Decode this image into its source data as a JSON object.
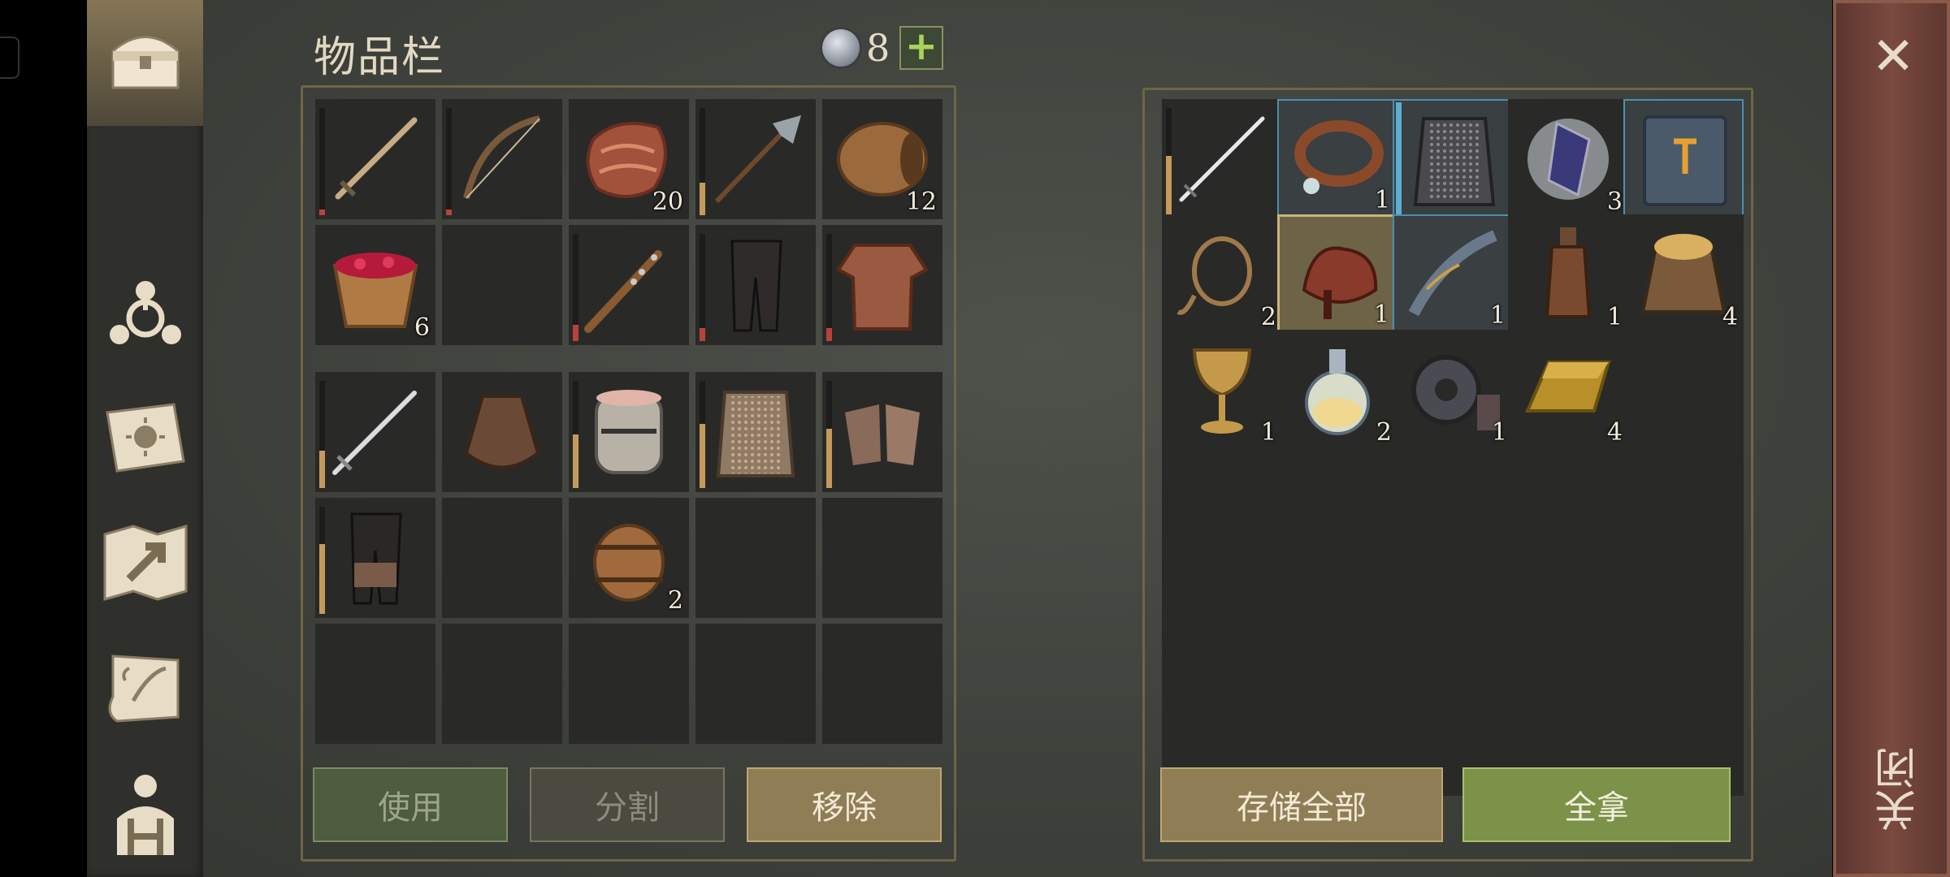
{
  "inventory": {
    "title": "物品栏",
    "currency_count": "8",
    "add_label": "+",
    "slots_main": [
      {
        "icon": "sword",
        "durability": 0.05,
        "dur_color": "#b8433a",
        "count": ""
      },
      {
        "icon": "bow",
        "durability": 0.05,
        "dur_color": "#b8433a",
        "count": ""
      },
      {
        "icon": "meat",
        "durability": null,
        "count": "20"
      },
      {
        "icon": "halberd",
        "durability": 0.3,
        "dur_color": "#c49a5c",
        "count": ""
      },
      {
        "icon": "barrel-log",
        "durability": null,
        "count": "12"
      },
      {
        "icon": "berry-bowl",
        "durability": null,
        "count": "6"
      },
      {
        "icon": "empty",
        "durability": null,
        "count": ""
      },
      {
        "icon": "spiked-club",
        "durability": 0.15,
        "dur_color": "#b8433a",
        "count": ""
      },
      {
        "icon": "leather-pants",
        "durability": 0.12,
        "dur_color": "#b8433a",
        "count": ""
      },
      {
        "icon": "leather-armor",
        "durability": 0.12,
        "dur_color": "#b8433a",
        "count": ""
      }
    ],
    "slots_bag": [
      {
        "icon": "steel-sword",
        "durability": 0.35,
        "dur_color": "#c49a5c",
        "count": ""
      },
      {
        "icon": "sack",
        "durability": null,
        "count": ""
      },
      {
        "icon": "great-helm",
        "durability": 0.5,
        "dur_color": "#c49a5c",
        "count": ""
      },
      {
        "icon": "chainmail",
        "durability": 0.6,
        "dur_color": "#c49a5c",
        "count": ""
      },
      {
        "icon": "mail-gloves",
        "durability": 0.55,
        "dur_color": "#c49a5c",
        "count": ""
      },
      {
        "icon": "mail-boots",
        "durability": 0.65,
        "dur_color": "#c49a5c",
        "count": ""
      },
      {
        "icon": "empty",
        "durability": null,
        "count": ""
      },
      {
        "icon": "keg",
        "durability": null,
        "count": "2"
      },
      {
        "icon": "empty",
        "durability": null,
        "count": ""
      },
      {
        "icon": "empty",
        "durability": null,
        "count": ""
      }
    ],
    "buttons": {
      "use": "使用",
      "split": "分割",
      "remove": "移除"
    }
  },
  "storage": {
    "slots": [
      {
        "icon": "longsword",
        "durability": 0.55,
        "dur_color": "#c49a5c",
        "count": "",
        "style": ""
      },
      {
        "icon": "collar",
        "count": "1",
        "style": "hl"
      },
      {
        "icon": "chain-armor",
        "count": "",
        "style": "hl",
        "side_bar": "#5fb0d0"
      },
      {
        "icon": "crystal",
        "count": "3",
        "style": ""
      },
      {
        "icon": "book",
        "count": "",
        "style": "hl"
      },
      {
        "icon": "rope",
        "count": "2",
        "style": ""
      },
      {
        "icon": "saddle",
        "count": "1",
        "style": "sel"
      },
      {
        "icon": "ornate-handle",
        "count": "1",
        "style": "hl"
      },
      {
        "icon": "bottle",
        "count": "1",
        "style": ""
      },
      {
        "icon": "grain-sack",
        "count": "4",
        "style": ""
      },
      {
        "icon": "goblet",
        "count": "1",
        "style": ""
      },
      {
        "icon": "potion",
        "count": "2",
        "style": ""
      },
      {
        "icon": "gear",
        "count": "1",
        "style": ""
      },
      {
        "icon": "gold-ingot",
        "count": "4",
        "style": ""
      }
    ],
    "buttons": {
      "store_all": "存储全部",
      "take_all": "全拿"
    }
  },
  "close": {
    "icon": "close-icon",
    "label": "关闭"
  },
  "sidebar": [
    {
      "icon": "chest-icon"
    },
    {
      "icon": "skills-icon"
    },
    {
      "icon": "recipe-book-icon"
    },
    {
      "icon": "map-icon"
    },
    {
      "icon": "scroll-icon"
    },
    {
      "icon": "character-icon"
    }
  ],
  "colors": {
    "accent_green": "#a8d35a",
    "frame_gold": "#c0a66f"
  }
}
